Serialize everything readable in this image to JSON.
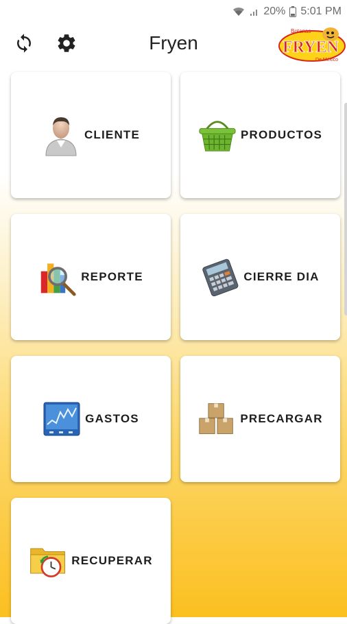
{
  "status": {
    "battery": "20%",
    "time": "5:01 PM"
  },
  "app_bar": {
    "title": "Fryen",
    "logo": {
      "top": "Botanas",
      "main": "FRYEN",
      "bottom": "De México"
    },
    "sync_icon": "sync-icon",
    "settings_icon": "gear-icon"
  },
  "menu": [
    {
      "label": "CLIENTE",
      "icon": "user-icon"
    },
    {
      "label": "PRODUCTOS",
      "icon": "basket-icon"
    },
    {
      "label": "REPORTE",
      "icon": "report-chart-icon"
    },
    {
      "label": "CIERRE DIA",
      "icon": "calculator-icon"
    },
    {
      "label": "GASTOS",
      "icon": "stock-chart-icon"
    },
    {
      "label": "PRECARGAR",
      "icon": "boxes-icon"
    },
    {
      "label": "RECUPERAR",
      "icon": "folder-clock-icon"
    }
  ],
  "colors": {
    "gradient_top": "#ffffff",
    "gradient_bottom": "#fbbf20",
    "logo_red": "#d9261c",
    "logo_yellow": "#ffd21a"
  }
}
